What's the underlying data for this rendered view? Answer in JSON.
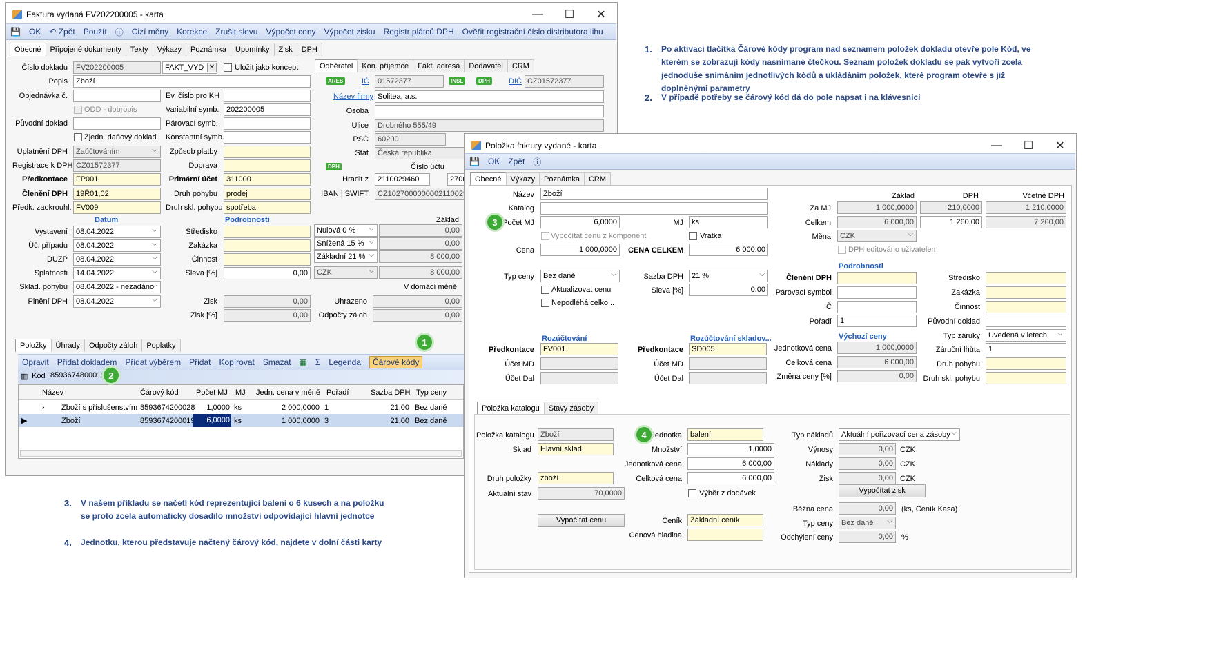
{
  "win1": {
    "title": "Faktura vydaná FV202200005 - karta",
    "toolbar": [
      "OK",
      "Zpět",
      "Použít",
      "Cizí měny",
      "Korekce",
      "Zrušit slevu",
      "Výpočet ceny",
      "Výpočet zisku",
      "Registr plátců DPH",
      "Ověřit registrační číslo distributora lihu"
    ],
    "tabs": [
      "Obecné",
      "Připojené dokumenty",
      "Texty",
      "Výkazy",
      "Poznámka",
      "Upomínky",
      "Zisk",
      "DPH"
    ],
    "fields": {
      "cislo_dokladu_label": "Číslo dokladu",
      "cislo_dokladu": "FV202200005",
      "rada": "FAKT_VYD",
      "koncept": "Uložit jako koncept",
      "popis_label": "Popis",
      "popis": "Zboží",
      "objednavka_label": "Objednávka č.",
      "ev_cislo_label": "Ev. číslo pro KH",
      "odd_label": "ODD - dobropis",
      "var_symb_label": "Variabilní symb.",
      "var_symb": "202200005",
      "puvodni_label": "Původní doklad",
      "parovaci_label": "Párovací symb.",
      "zjedn_label": "Zjedn. daňový doklad",
      "konst_label": "Konstantní symb.",
      "uplatneni_label": "Uplatnění DPH",
      "uplatneni": "Zaúčtováním",
      "zpusob_label": "Způsob platby",
      "registrace_label": "Registrace k DPH",
      "registrace": "CZ01572377",
      "doprava_label": "Doprava",
      "predkontace_label": "Předkontace",
      "predkontace": "FP001",
      "primarni_label": "Primární účet",
      "primarni": "311000",
      "cleneni_label": "Členění DPH",
      "cleneni": "19Ř01,02",
      "druh_pohybu_label": "Druh pohybu",
      "druh_pohybu": "prodej",
      "zaokr_label": "Předk. zaokrouhl.",
      "zaokr": "FV009",
      "druh_skl_label": "Druh skl. pohybu",
      "druh_skl": "spotřeba",
      "datum_hdr": "Datum",
      "podrobnosti_hdr": "Podrobnosti",
      "zaklad_hdr": "Základ",
      "vystaveni_label": "Vystavení",
      "vystaveni": "08.04.2022",
      "stredisko_label": "Středisko",
      "uc_pripadu_label": "Úč. případu",
      "uc_pripadu": "08.04.2022",
      "zakazka_label": "Zakázka",
      "duzp_label": "DUZP",
      "duzp": "08.04.2022",
      "cinnost_label": "Činnost",
      "splatnosti_label": "Splatnosti",
      "splatnosti": "14.04.2022",
      "sleva_label": "Sleva [%]",
      "sleva": "0,00",
      "sklad_pohybu_label": "Sklad. pohybu",
      "sklad_pohybu": "08.04.2022 - nezadáno",
      "plneni_label": "Plnění DPH",
      "plneni": "08.04.2022",
      "zisk_label": "Zisk",
      "zisk": "0,00",
      "zisk_pct_label": "Zisk [%]",
      "zisk_pct": "0,00",
      "vat1": "Nulová 0 %",
      "vat1_val": "0,00",
      "vat2": "Snížená 15 %",
      "vat2_val": "0,00",
      "vat3": "Základní 21 %",
      "vat3_val": "8 000,00",
      "mena": "CZK",
      "mena_val": "8 000,00",
      "v_domaci": "V domácí měně",
      "uhrazeno_label": "Uhrazeno",
      "uhrazeno": "0,00",
      "odpocty_label": "Odpočty záloh",
      "odpocty": "0,00"
    },
    "partner_tabs": [
      "Odběratel",
      "Kon. příjemce",
      "Fakt. adresa",
      "Dodavatel",
      "CRM"
    ],
    "partner": {
      "ares": "ARES",
      "ic_label": "IČ",
      "ic": "01572377",
      "insl": "INSL",
      "dph": "DPH",
      "dic_label": "DIČ",
      "dic": "CZ01572377",
      "nazev_label": "Název firmy",
      "nazev": "Solitea, a.s.",
      "osoba_label": "Osoba",
      "ulice_label": "Ulice",
      "ulice": "Drobného 555/49",
      "psc_label": "PSČ",
      "psc": "60200",
      "stat_label": "Stát",
      "stat": "Česká republika",
      "cislo_uctu_label": "Číslo účtu",
      "hradit_label": "Hradit z",
      "hradit": "2110029460",
      "hradit_bank": "2700",
      "iban_label": "IBAN | SWIFT",
      "iban": "CZ1027000000002110029460"
    },
    "bottom_tabs": [
      "Položky",
      "Úhrady",
      "Odpočty záloh",
      "Poplatky"
    ],
    "items_toolbar": [
      "Opravit",
      "Přidat dokladem",
      "Přidat výběrem",
      "Přidat",
      "Kopírovat",
      "Smazat",
      "Σ",
      "Legenda",
      "Čárové kódy"
    ],
    "kod_label": "Kód",
    "kod": "8593674800019",
    "grid_headers": [
      "Název",
      "Čárový kód",
      "Počet MJ",
      "MJ",
      "Jedn. cena v měně",
      "Pořadí",
      "Sazba DPH",
      "Typ ceny"
    ],
    "grid_rows": [
      [
        "Zboží s příslušenstvím",
        "8593674200028",
        "1,0000",
        "ks",
        "2 000,0000",
        "1",
        "21,00",
        "Bez daně"
      ],
      [
        "Zboží",
        "8593674200019",
        "6,0000",
        "ks",
        "1 000,0000",
        "3",
        "21,00",
        "Bez daně"
      ]
    ]
  },
  "win2": {
    "title": "Položka faktury vydané - karta",
    "toolbar": [
      "OK",
      "Zpět"
    ],
    "tabs": [
      "Obecné",
      "Výkazy",
      "Poznámka",
      "CRM"
    ],
    "f": {
      "nazev_label": "Název",
      "nazev": "Zboží",
      "katalog_label": "Katalog",
      "pocet_label": "Počet MJ",
      "pocet": "6,0000",
      "mj_label": "MJ",
      "mj": "ks",
      "vypocitat_label": "Vypočítat cenu z komponent",
      "vratka_label": "Vratka",
      "cena_label": "Cena",
      "cena": "1 000,0000",
      "cena_celkem_label": "CENA CELKEM",
      "cena_celkem": "6 000,00",
      "typ_ceny_label": "Typ ceny",
      "typ_ceny": "Bez daně",
      "sazba_label": "Sazba DPH",
      "sazba": "21 %",
      "aktualizovat_label": "Aktualizovat cenu",
      "sleva_label": "Sleva [%]",
      "sleva": "0,00",
      "nepodlaha_label": "Nepodléhá celko...",
      "hdr_zaklad": "Základ",
      "hdr_dph": "DPH",
      "hdr_vcetne": "Včetně DPH",
      "za_mj_label": "Za MJ",
      "za_mj_zaklad": "1 000,0000",
      "za_mj_dph": "210,0000",
      "za_mj_vc": "1 210,0000",
      "celkem_label": "Celkem",
      "celkem_zaklad": "6 000,00",
      "celkem_dph": "1 260,00",
      "celkem_vc": "7 260,00",
      "mena_label": "Měna",
      "mena": "CZK",
      "dph_edit_label": "DPH editováno uživatelem",
      "podrobnosti_hdr": "Podrobnosti",
      "cleneni_label": "Členění DPH",
      "stredisko_label": "Středisko",
      "parovaci_label": "Párovací symbol",
      "zakazka_label": "Zakázka",
      "ic_label": "IČ",
      "cinnost_label": "Činnost",
      "poradi_label": "Pořadí",
      "poradi": "1",
      "puvodni_label": "Původní doklad",
      "rozuct_hdr": "Rozúčtování",
      "rozuct_skl_hdr": "Rozúčtování skladov...",
      "vychozi_hdr": "Výchozí ceny",
      "predkontace_label": "Předkontace",
      "predkontace": "FV001",
      "predkontace2": "SD005",
      "ucet_md_label": "Účet MD",
      "ucet_dal_label": "Účet Dal",
      "jedn_cena_label": "Jednotková cena",
      "jedn_cena": "1 000,0000",
      "celk_cena_label": "Celková cena",
      "celk_cena": "6 000,00",
      "zmena_label": "Změna ceny [%]",
      "zmena": "0,00",
      "typ_zaruky_label": "Typ záruky",
      "typ_zaruky": "Uvedená v letech",
      "zarucni_label": "Záruční lhůta",
      "zarucni": "1",
      "druh_pohybu_label": "Druh pohybu",
      "druh_skl_label": "Druh skl. pohybu"
    },
    "sub_tabs": [
      "Položka katalogu",
      "Stavy zásoby"
    ],
    "k": {
      "polozka_label": "Položka katalogu",
      "polozka": "Zboží",
      "sklad_label": "Sklad",
      "sklad": "Hlavní sklad",
      "druh_label": "Druh položky",
      "druh": "zboží",
      "stav_label": "Aktuální stav",
      "stav": "70,0000",
      "vyp_cenu_btn": "Vypočítat cenu",
      "jednotka_label": "Jednotka",
      "jednotka": "balení",
      "mnozstvi_label": "Množství",
      "mnozstvi": "1,0000",
      "jedn_cena_label": "Jednotková cena",
      "jedn_cena": "6 000,00",
      "celk_cena_label": "Celková cena",
      "celk_cena": "6 000,00",
      "vyber_label": "Výběr z dodávek",
      "cenik_label": "Ceník",
      "cenik": "Základní ceník",
      "hladina_label": "Cenová hladina",
      "typ_nakladu_label": "Typ nákladů",
      "typ_nakladu": "Aktuální pořizovací cena zásoby",
      "vynosy_label": "Výnosy",
      "vynosy": "0,00",
      "naklady_label": "Náklady",
      "naklady": "0,00",
      "zisk_label": "Zisk",
      "zisk": "0,00",
      "czk": "CZK",
      "vyp_zisk_btn": "Vypočítat zisk",
      "bezna_label": "Běžná cena",
      "bezna": "0,00",
      "bezna_note": "(ks, Ceník Kasa)",
      "typ_ceny_label": "Typ ceny",
      "typ_ceny": "Bez daně",
      "odchyleni_label": "Odchýlení ceny",
      "odchyleni": "0,00",
      "pct": "%"
    }
  },
  "badges": [
    "1",
    "2",
    "3",
    "4"
  ],
  "notes": [
    {
      "n": "1.",
      "text": "Po aktivaci tlačítka Čárové kódy program nad seznamem položek dokladu otevře pole Kód, ve kterém se zobrazují kódy nasnímané čtečkou. Seznam položek dokladu se pak vytvoří zcela jednoduše snímáním jednotlivých kódů a ukládáním položek, které program otevře s již doplněnými parametry"
    },
    {
      "n": "2.",
      "text": "V případě potřeby se čárový kód dá do pole napsat i na klávesnici"
    },
    {
      "n": "3.",
      "text": "V našem příkladu se načetl kód reprezentující balení o 6 kusech a na položku se proto zcela automaticky dosadilo množství odpovídající hlavní jednotce"
    },
    {
      "n": "4.",
      "text": "Jednotku, kterou představuje načtený čárový kód, najdete v dolní části karty"
    }
  ],
  "colors": {
    "accent": "#1f5fbf",
    "badge": "#3daa35",
    "yellow_field": "#fffbd6",
    "note_text": "#2b4a8a"
  }
}
